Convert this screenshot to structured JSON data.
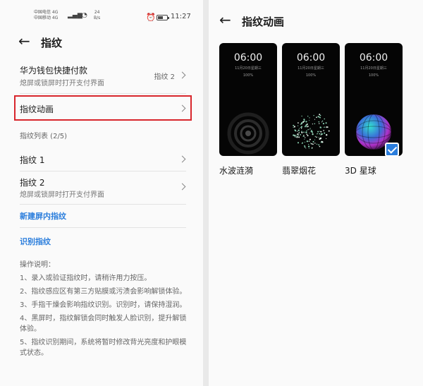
{
  "status_bar": {
    "carrier_1": "中国电信 4G",
    "carrier_2": "中国移动 4G",
    "net_speed": "24",
    "net_unit": "B/s",
    "time": "11:27"
  },
  "left": {
    "title": "指纹",
    "wallet_row": {
      "title": "华为钱包快捷付款",
      "subtitle": "熄屏或锁屏时打开支付界面",
      "value": "指纹 2"
    },
    "animation_row": {
      "title": "指纹动画"
    },
    "list_header": "指纹列表 (2/5)",
    "fingerprints": [
      {
        "title": "指纹 1",
        "subtitle": ""
      },
      {
        "title": "指纹 2",
        "subtitle": "熄屏或锁屏时打开支付界面"
      }
    ],
    "new_fingerprint_link": "新建屏内指纹",
    "identify_link": "识别指纹",
    "notes": [
      "操作说明：",
      "1、录入或验证指纹时，请稍许用力按压。",
      "2、指纹感应区有第三方贴膜或污渍会影响解锁体验。",
      "3、手指干燥会影响指纹识别。识别时，请保持湿润。",
      "4、黑屏时，指纹解锁会同时触发人脸识别，提升解锁体验。",
      "5、指纹识别期间，系统将暂时修改背光亮度和护眼模式状态。"
    ]
  },
  "right": {
    "title": "指纹动画",
    "options": [
      {
        "time": "06:00",
        "date": "11月20日星期三",
        "battery": "100%",
        "caption": "水波涟漪",
        "selected": false
      },
      {
        "time": "06:00",
        "date": "11月20日星期三",
        "battery": "100%",
        "caption": "翡翠烟花",
        "selected": false
      },
      {
        "time": "06:00",
        "date": "11月20日星期三",
        "battery": "100%",
        "caption": "3D 星球",
        "selected": true
      }
    ]
  },
  "colors": {
    "accent": "#2a7ddc",
    "highlight_box": "#d8262c",
    "preview_bg": "#050505"
  },
  "icons": {
    "back": "arrow-left-icon",
    "chevron": "chevron-right-icon",
    "check": "check-icon"
  }
}
